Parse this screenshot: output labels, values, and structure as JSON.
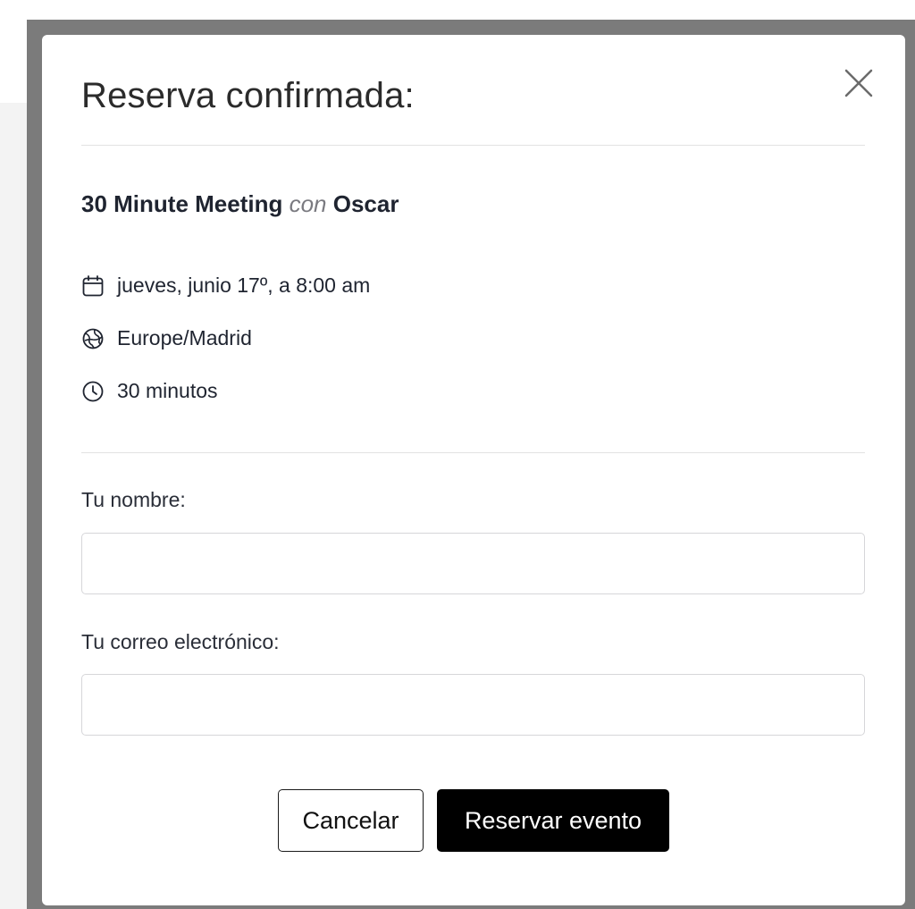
{
  "modal": {
    "title": "Reserva confirmada:",
    "event": {
      "name": "30 Minute Meeting",
      "connector": "con",
      "host": "Oscar"
    },
    "details": {
      "date": "jueves, junio 17º, a 8:00 am",
      "timezone": "Europe/Madrid",
      "duration": "30 minutos"
    },
    "form": {
      "name_label": "Tu nombre:",
      "name_value": "",
      "email_label": "Tu correo electrónico:",
      "email_value": ""
    },
    "buttons": {
      "cancel_label": "Cancelar",
      "submit_label": "Reservar evento"
    },
    "icons": {
      "close": "close-icon",
      "date": "calendar-icon",
      "timezone": "globe-icon",
      "duration": "clock-icon"
    }
  }
}
